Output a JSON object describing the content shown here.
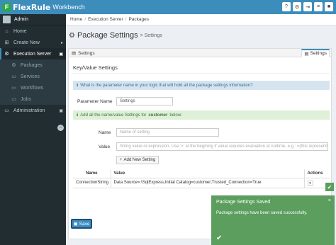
{
  "app": {
    "brand": "FlexRule",
    "product": "Workbench",
    "logo_letter": "F"
  },
  "topbar": {
    "icons": [
      "help-icon",
      "gear-icon",
      "sign-out-icon",
      "menu-icon",
      "user-icon"
    ],
    "glyphs": [
      "?",
      "⚙",
      "⇥",
      "≡",
      "■"
    ]
  },
  "sidebar": {
    "user": "Admin",
    "items": [
      {
        "label": "Home",
        "glyph": "⌂"
      },
      {
        "label": "Create New",
        "glyph": "⊞",
        "expander": "▸"
      },
      {
        "label": "Execution Server",
        "glyph": "⚙",
        "expander": "▣"
      }
    ],
    "sub_items": [
      {
        "label": "Packages",
        "glyph": "⚙"
      },
      {
        "label": "Services",
        "glyph": "▭"
      },
      {
        "label": "Workflows",
        "glyph": "▭"
      },
      {
        "label": "Jobs",
        "glyph": "▭"
      }
    ],
    "admin": {
      "label": "Administration",
      "glyph": "▭",
      "expander": "▣"
    },
    "collapse_glyph": "−"
  },
  "breadcrumb": [
    "Home",
    "Execution Server",
    "Packages"
  ],
  "breadcrumb_sep": "/",
  "page": {
    "title": "Package Settings",
    "subtitle": "> Settings",
    "icon_glyph": "⚙"
  },
  "tabs": {
    "left": "Settings",
    "right": "Settings",
    "glyph": "▤"
  },
  "section_title": "Key/Value Settings",
  "info_alert": {
    "glyph": "ℹ",
    "text": "What is the parameter name in your logic that will hold all the package settings information?"
  },
  "param": {
    "label": "Parameter Name",
    "value": "Settings"
  },
  "success_alert": {
    "glyph": "ℹ",
    "pre": "Add all the name/value Settings for",
    "bold": "customer",
    "post": "below:"
  },
  "name_field": {
    "label": "Name",
    "placeholder": "Name of setting"
  },
  "value_field": {
    "label": "Value",
    "placeholder": "String value or expression. Use '=' at the begining if value requires evaluation at runtime, e.g.: =(this represents an int"
  },
  "add_button": {
    "glyph": "+",
    "label": "Add New Setting"
  },
  "table": {
    "headers": [
      "Name",
      "Value",
      "Actions"
    ],
    "rows": [
      {
        "name": "ConnectionString",
        "value": "Data Source=.\\SqlExpress;Initial Catalog=customer;Trusted_Connection=True",
        "action": "▾"
      }
    ]
  },
  "save_button": {
    "glyph": "▣",
    "label": "Save"
  },
  "toast": {
    "title": "Package Settings Saved",
    "close": "×",
    "message": "Package settings have been saved successfully.",
    "check": "✔",
    "mini_check": "✔"
  }
}
